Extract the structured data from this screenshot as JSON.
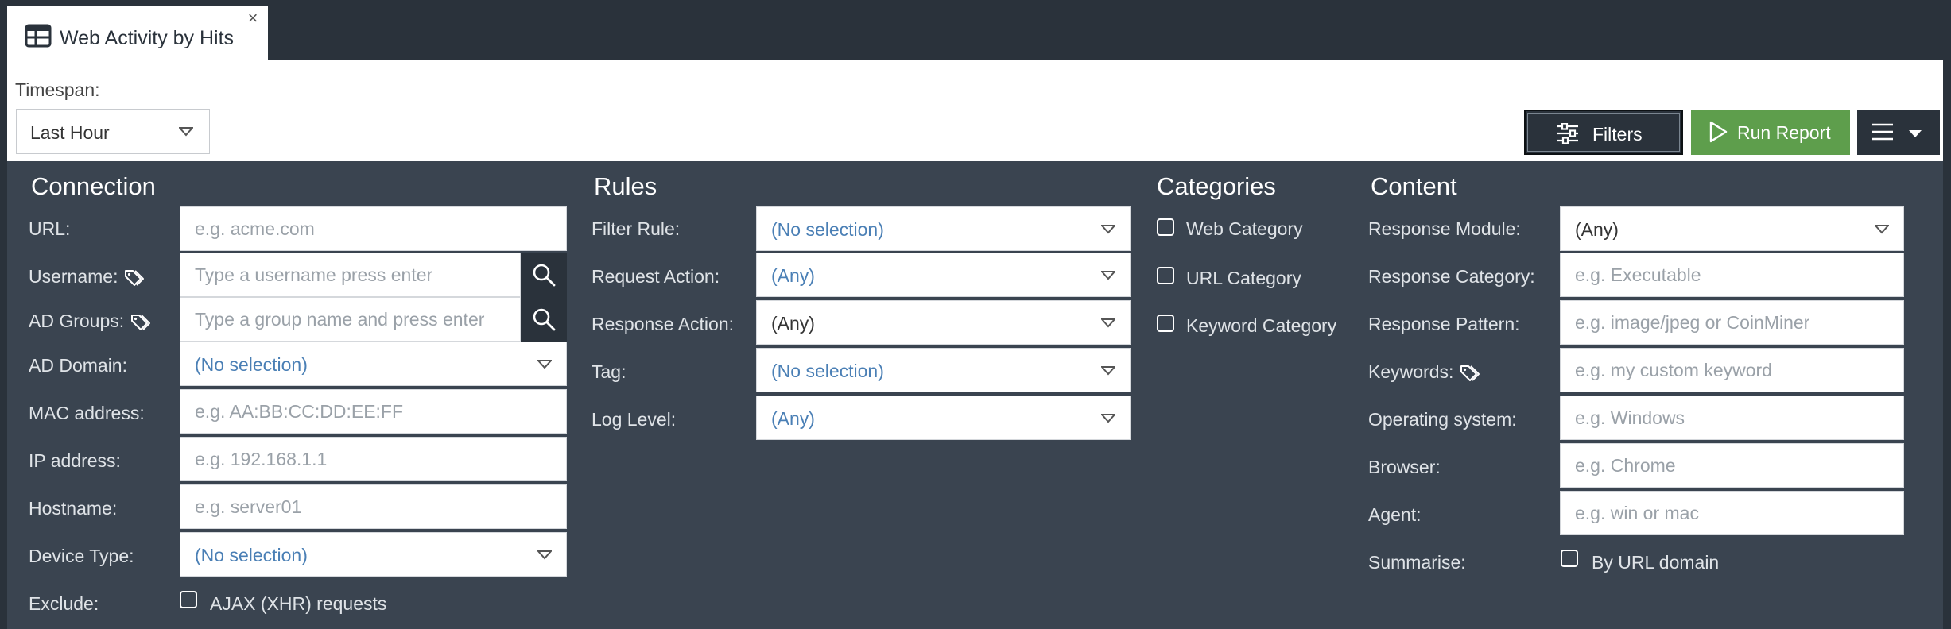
{
  "tab": {
    "title": "Web Activity by Hits",
    "close": "×",
    "icon": "table-icon"
  },
  "toolbar": {
    "timespan_label": "Timespan:",
    "timespan_value": "Last Hour",
    "filters_label": "Filters",
    "run_label": "Run Report"
  },
  "connection": {
    "title": "Connection",
    "url_label": "URL:",
    "url_placeholder": "e.g. acme.com",
    "username_label": "Username:",
    "username_placeholder": "Type a username press enter",
    "adgroups_label": "AD Groups:",
    "adgroups_placeholder": "Type a group name and press enter",
    "addomain_label": "AD Domain:",
    "addomain_value": "(No selection)",
    "mac_label": "MAC address:",
    "mac_placeholder": "e.g. AA:BB:CC:DD:EE:FF",
    "ip_label": "IP address:",
    "ip_placeholder": "e.g. 192.168.1.1",
    "hostname_label": "Hostname:",
    "hostname_placeholder": "e.g. server01",
    "devicetype_label": "Device Type:",
    "devicetype_value": "(No selection)",
    "exclude_label": "Exclude:",
    "exclude_option": "AJAX (XHR) requests"
  },
  "rules": {
    "title": "Rules",
    "filterrule_label": "Filter Rule:",
    "filterrule_value": "(No selection)",
    "requestaction_label": "Request Action:",
    "requestaction_value": "(Any)",
    "responseaction_label": "Response Action:",
    "responseaction_value": "(Any)",
    "tag_label": "Tag:",
    "tag_value": "(No selection)",
    "loglevel_label": "Log Level:",
    "loglevel_value": "(Any)"
  },
  "categories": {
    "title": "Categories",
    "items": [
      "Web Category",
      "URL Category",
      "Keyword Category"
    ]
  },
  "content": {
    "title": "Content",
    "responsemodule_label": "Response Module:",
    "responsemodule_value": "(Any)",
    "responsecategory_label": "Response Category:",
    "responsecategory_placeholder": "e.g. Executable",
    "responsepattern_label": "Response Pattern:",
    "responsepattern_placeholder": "e.g. image/jpeg or CoinMiner",
    "keywords_label": "Keywords:",
    "keywords_placeholder": "e.g. my custom keyword",
    "os_label": "Operating system:",
    "os_placeholder": "e.g. Windows",
    "browser_label": "Browser:",
    "browser_placeholder": "e.g. Chrome",
    "agent_label": "Agent:",
    "agent_placeholder": "e.g. win or mac",
    "summarise_label": "Summarise:",
    "summarise_option": "By URL domain"
  },
  "colors": {
    "header_bg": "#2a323b",
    "panel_bg": "#3a4450",
    "run_green": "#5e9e4c",
    "link_blue": "#4a7fb5"
  }
}
